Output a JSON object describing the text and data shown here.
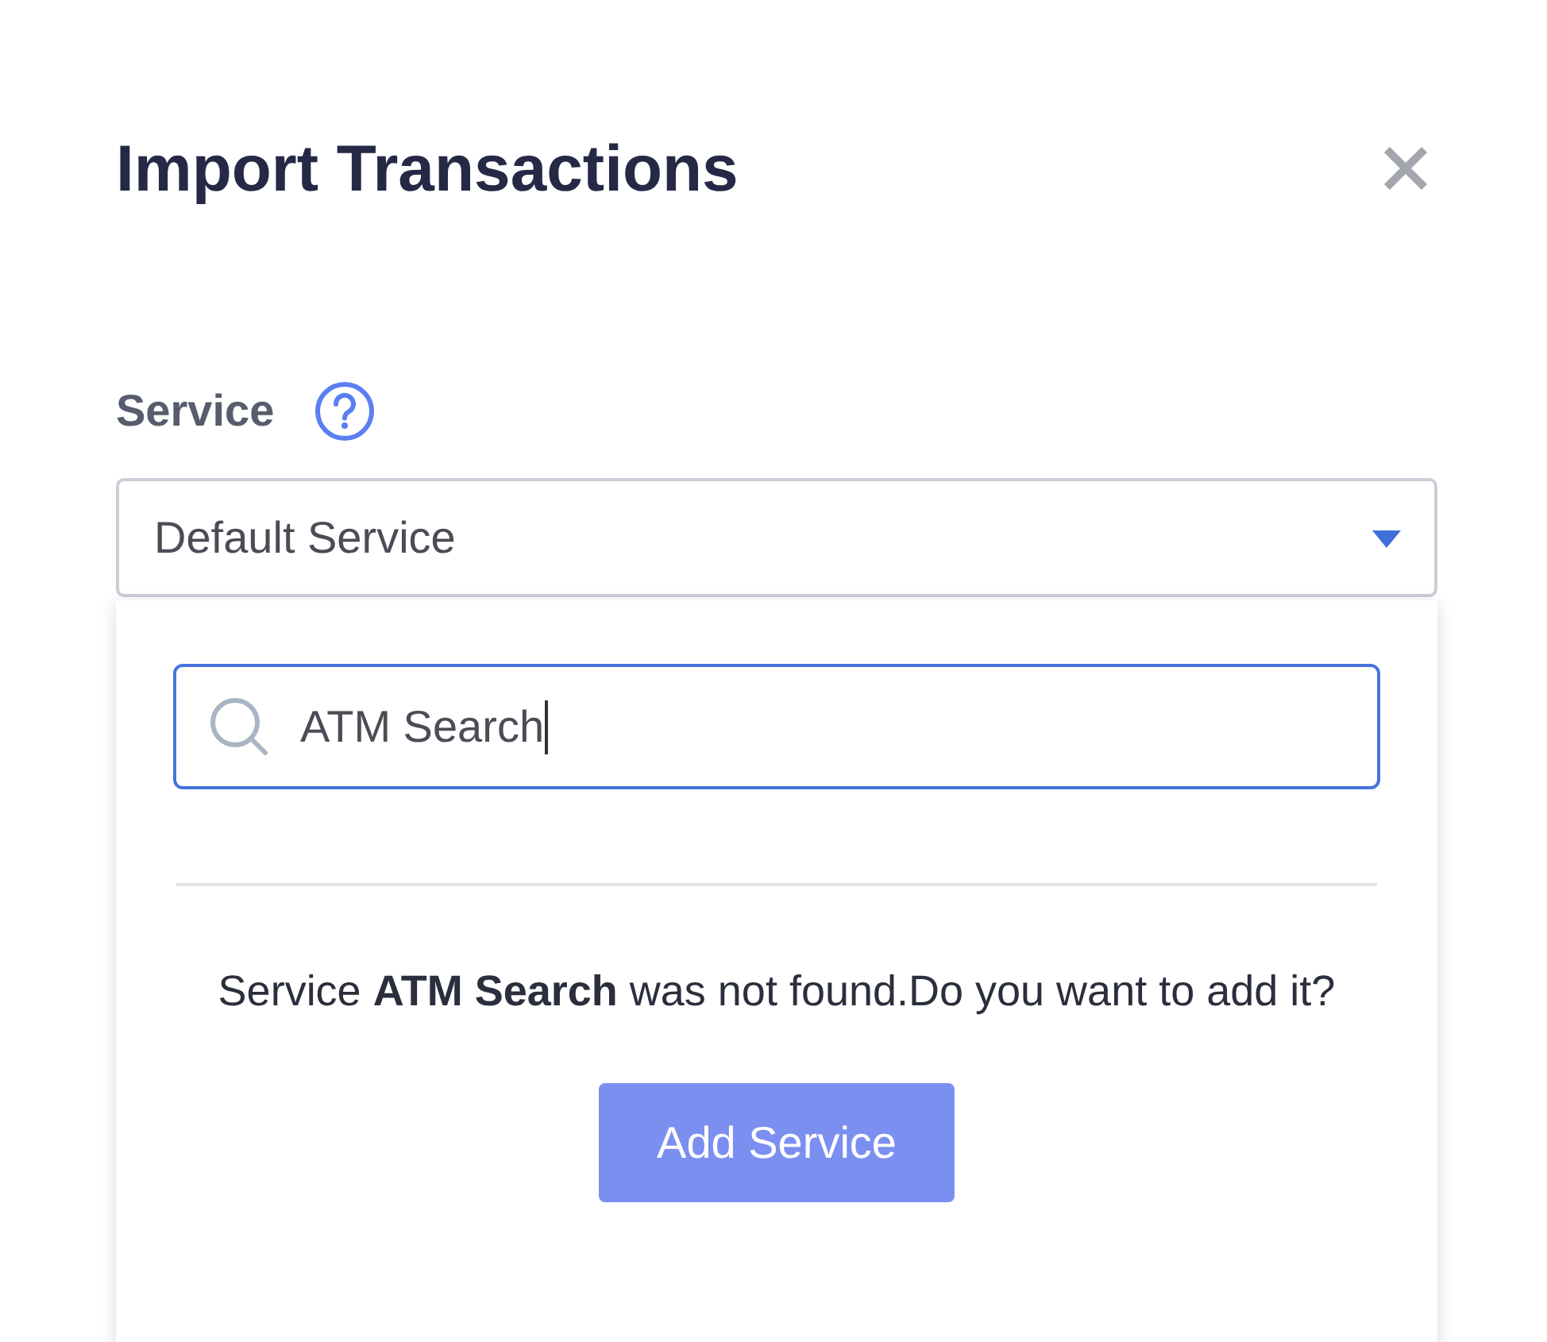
{
  "dialog": {
    "title": "Import Transactions"
  },
  "service": {
    "label": "Service",
    "select_value": "Default Service",
    "dropdown_expanded": true
  },
  "dropdown": {
    "search_value": "ATM Search",
    "message": "Service **ATM Search** was not found.Do you want to add it?",
    "button": "Add Service"
  }
}
